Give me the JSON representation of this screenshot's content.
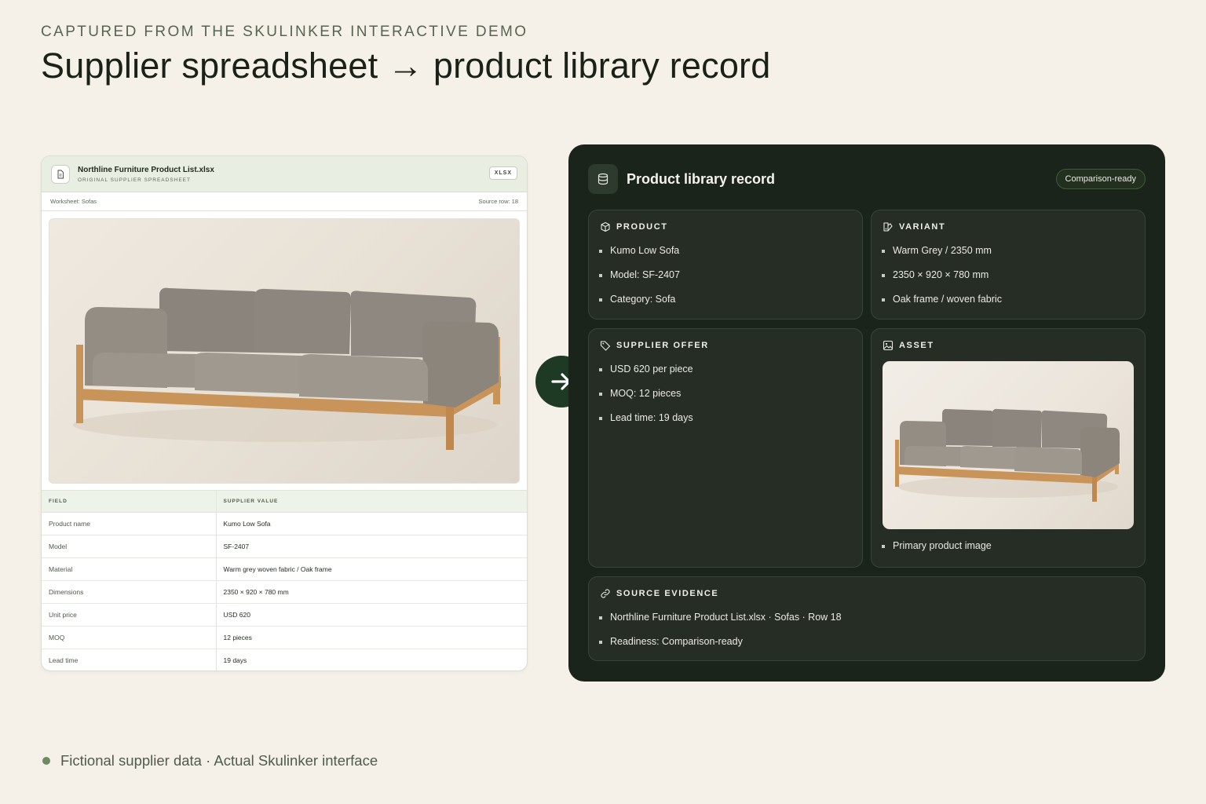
{
  "header": {
    "eyebrow": "CAPTURED FROM THE SKULINKER INTERACTIVE DEMO",
    "title": "Supplier spreadsheet → product library record"
  },
  "spreadsheet": {
    "file_name": "Northline Furniture Product List.xlsx",
    "file_subtitle": "ORIGINAL SUPPLIER SPREADSHEET",
    "badge": "XLSX",
    "worksheet": "Worksheet: Sofas",
    "source_row": "Source row: 18",
    "columns": [
      "FIELD",
      "SUPPLIER VALUE"
    ],
    "rows": [
      {
        "field": "Product name",
        "value": "Kumo Low Sofa"
      },
      {
        "field": "Model",
        "value": "SF-2407"
      },
      {
        "field": "Material",
        "value": "Warm grey woven fabric / Oak frame"
      },
      {
        "field": "Dimensions",
        "value": "2350 × 920 × 780 mm"
      },
      {
        "field": "Unit price",
        "value": "USD 620"
      },
      {
        "field": "MOQ",
        "value": "12 pieces"
      },
      {
        "field": "Lead time",
        "value": "19 days"
      }
    ]
  },
  "record": {
    "title": "Product library record",
    "badge": "Comparison-ready",
    "product": {
      "heading": "PRODUCT",
      "items": [
        "Kumo Low Sofa",
        "Model: SF-2407",
        "Category: Sofa"
      ]
    },
    "variant": {
      "heading": "VARIANT",
      "items": [
        "Warm Grey / 2350 mm",
        "2350 × 920 × 780 mm",
        "Oak frame / woven fabric"
      ]
    },
    "offer": {
      "heading": "SUPPLIER OFFER",
      "items": [
        "USD 620 per piece",
        "MOQ: 12 pieces",
        "Lead time: 19 days"
      ]
    },
    "asset": {
      "heading": "ASSET",
      "items": [
        "Primary product image"
      ]
    },
    "evidence": {
      "heading": "SOURCE EVIDENCE",
      "items": [
        "Northline Furniture Product List.xlsx · Sofas · Row 18",
        "Readiness: Comparison-ready"
      ]
    }
  },
  "footer": {
    "text": "Fictional supplier data · Actual Skulinker interface"
  },
  "colors": {
    "background": "#f5f1e8",
    "panel": "#1b241b",
    "accent": "#1f3a24",
    "sheet_header": "#e8efe2"
  },
  "icons": [
    "file-icon",
    "database-icon",
    "box-icon",
    "variant-icon",
    "tag-icon",
    "image-icon",
    "link-icon",
    "arrow-right-icon"
  ]
}
